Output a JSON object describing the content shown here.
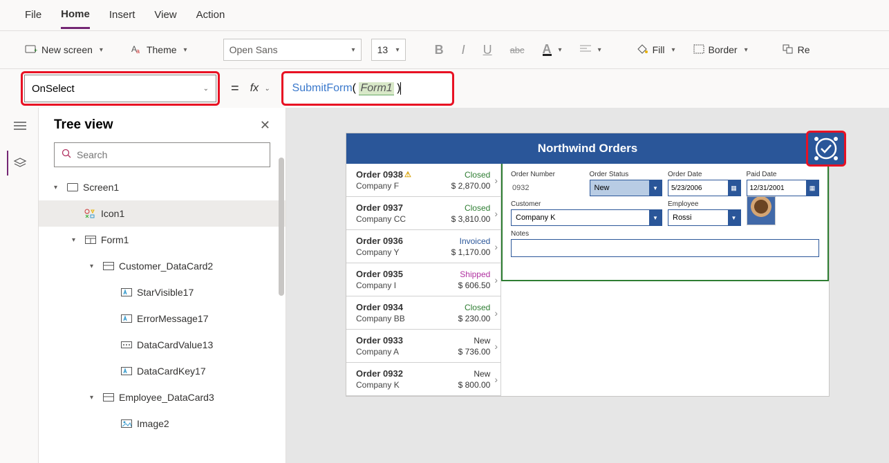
{
  "menu": {
    "file": "File",
    "home": "Home",
    "insert": "Insert",
    "view": "View",
    "action": "Action"
  },
  "ribbon": {
    "new_screen": "New screen",
    "theme": "Theme",
    "font_name": "Open Sans",
    "font_size": "13",
    "fill": "Fill",
    "border": "Border",
    "reorder": "Re"
  },
  "formula": {
    "property": "OnSelect",
    "fn": "SubmitForm",
    "arg": "Form1"
  },
  "tree": {
    "title": "Tree view",
    "search_placeholder": "Search",
    "items": [
      {
        "indent": 0,
        "label": "Screen1",
        "icon": "screen",
        "tri": "▾"
      },
      {
        "indent": 1,
        "label": "Icon1",
        "icon": "iconset",
        "tri": "",
        "selected": true
      },
      {
        "indent": 1,
        "label": "Form1",
        "icon": "form",
        "tri": "▾"
      },
      {
        "indent": 2,
        "label": "Customer_DataCard2",
        "icon": "card",
        "tri": "▾"
      },
      {
        "indent": 3,
        "label": "StarVisible17",
        "icon": "label",
        "tri": ""
      },
      {
        "indent": 3,
        "label": "ErrorMessage17",
        "icon": "label",
        "tri": ""
      },
      {
        "indent": 3,
        "label": "DataCardValue13",
        "icon": "input",
        "tri": ""
      },
      {
        "indent": 3,
        "label": "DataCardKey17",
        "icon": "label",
        "tri": ""
      },
      {
        "indent": 2,
        "label": "Employee_DataCard3",
        "icon": "card",
        "tri": "▾"
      },
      {
        "indent": 3,
        "label": "Image2",
        "icon": "image",
        "tri": ""
      }
    ]
  },
  "preview": {
    "title": "Northwind Orders",
    "orders": [
      {
        "num": "Order 0938",
        "warn": true,
        "company": "Company F",
        "status": "Closed",
        "status_cls": "closed",
        "amount": "$ 2,870.00"
      },
      {
        "num": "Order 0937",
        "warn": false,
        "company": "Company CC",
        "status": "Closed",
        "status_cls": "closed",
        "amount": "$ 3,810.00"
      },
      {
        "num": "Order 0936",
        "warn": false,
        "company": "Company Y",
        "status": "Invoiced",
        "status_cls": "invoiced",
        "amount": "$ 1,170.00"
      },
      {
        "num": "Order 0935",
        "warn": false,
        "company": "Company I",
        "status": "Shipped",
        "status_cls": "shipped",
        "amount": "$ 606.50"
      },
      {
        "num": "Order 0934",
        "warn": false,
        "company": "Company BB",
        "status": "Closed",
        "status_cls": "closed",
        "amount": "$ 230.00"
      },
      {
        "num": "Order 0933",
        "warn": false,
        "company": "Company A",
        "status": "New",
        "status_cls": "new",
        "amount": "$ 736.00"
      },
      {
        "num": "Order 0932",
        "warn": false,
        "company": "Company K",
        "status": "New",
        "status_cls": "new",
        "amount": "$ 800.00"
      }
    ],
    "form": {
      "order_number_label": "Order Number",
      "order_number": "0932",
      "order_status_label": "Order Status",
      "order_status": "New",
      "order_date_label": "Order Date",
      "order_date": "5/23/2006",
      "paid_date_label": "Paid Date",
      "paid_date": "12/31/2001",
      "customer_label": "Customer",
      "customer": "Company K",
      "employee_label": "Employee",
      "employee": "Rossi",
      "notes_label": "Notes"
    }
  }
}
